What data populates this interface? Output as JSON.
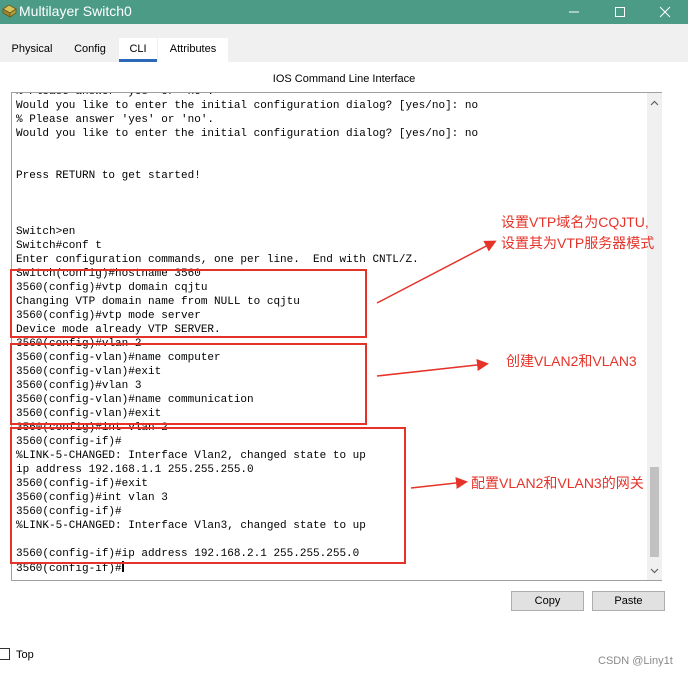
{
  "window": {
    "title": "Multilayer Switch0",
    "app_icon": "router-icon"
  },
  "tabs": [
    {
      "label": "Physical",
      "active": false
    },
    {
      "label": "Config",
      "active": false
    },
    {
      "label": "CLI",
      "active": true
    },
    {
      "label": "Attributes",
      "active": false
    }
  ],
  "panel": {
    "title": "IOS Command Line Interface"
  },
  "terminal": {
    "lines": [
      "% Please answer 'yes' or 'no'.",
      "Would you like to enter the initial configuration dialog? [yes/no]: no",
      "% Please answer 'yes' or 'no'.",
      "Would you like to enter the initial configuration dialog? [yes/no]: no",
      "",
      "",
      "Press RETURN to get started!",
      "",
      "",
      "",
      "Switch>en",
      "Switch#conf t",
      "Enter configuration commands, one per line.  End with CNTL/Z.",
      "Switch(config)#hostname 3560",
      "3560(config)#vtp domain cqjtu",
      "Changing VTP domain name from NULL to cqjtu",
      "3560(config)#vtp mode server",
      "Device mode already VTP SERVER.",
      "3560(config)#vlan 2",
      "3560(config-vlan)#name computer",
      "3560(config-vlan)#exit",
      "3560(config)#vlan 3",
      "3560(config-vlan)#name communication",
      "3560(config-vlan)#exit",
      "3560(config)#int vlan 2",
      "3560(config-if)#",
      "%LINK-5-CHANGED: Interface Vlan2, changed state to up",
      "ip address 192.168.1.1 255.255.255.0",
      "3560(config-if)#exit",
      "3560(config)#int vlan 3",
      "3560(config-if)#",
      "%LINK-5-CHANGED: Interface Vlan3, changed state to up",
      "",
      "3560(config-if)#ip address 192.168.2.1 255.255.255.0",
      "3560(config-if)#"
    ]
  },
  "buttons": {
    "copy": "Copy",
    "paste": "Paste"
  },
  "footer": {
    "top_label": "Top",
    "top_checked": false,
    "watermark": "CSDN @Liny1t"
  },
  "annotations": {
    "vtp_line1": "设置VTP域名为CQJTU,",
    "vtp_line2": "设置其为VTP服务器模式",
    "vlan": "创建VLAN2和VLAN3",
    "gateway": "配置VLAN2和VLAN3的网关"
  },
  "colors": {
    "titlebar": "#4b9b87",
    "annotation": "#e6332a",
    "active_tab_underline": "#2a69b8"
  }
}
